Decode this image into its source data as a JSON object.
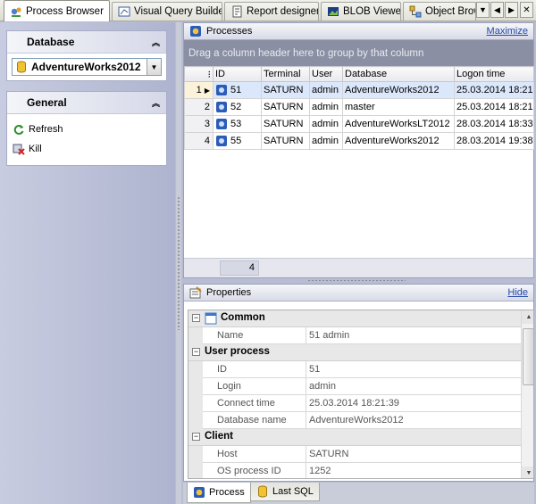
{
  "tabs": [
    {
      "label": "Process Browser",
      "icon": "process-browser-icon",
      "active": true
    },
    {
      "label": "Visual Query Builder",
      "icon": "query-builder-icon",
      "active": false
    },
    {
      "label": "Report designer",
      "icon": "report-designer-icon",
      "active": false
    },
    {
      "label": "BLOB Viewer",
      "icon": "blob-viewer-icon",
      "active": false
    },
    {
      "label": "Object Brow",
      "icon": "object-browser-icon",
      "active": false
    }
  ],
  "left": {
    "database_title": "Database",
    "database_value": "AdventureWorks2012",
    "general_title": "General",
    "actions": [
      {
        "label": "Refresh",
        "icon": "refresh-icon"
      },
      {
        "label": "Kill",
        "icon": "kill-icon"
      }
    ]
  },
  "processes": {
    "title": "Processes",
    "maximize": "Maximize",
    "group_hint": "Drag a column header here to group by that column",
    "columns": [
      "ID",
      "Terminal",
      "User",
      "Database",
      "Logon time"
    ],
    "rows": [
      {
        "n": "1",
        "id": "51",
        "terminal": "SATURN",
        "user": "admin",
        "database": "AdventureWorks2012",
        "logon": "25.03.2014 18:21"
      },
      {
        "n": "2",
        "id": "52",
        "terminal": "SATURN",
        "user": "admin",
        "database": "master",
        "logon": "25.03.2014 18:21"
      },
      {
        "n": "3",
        "id": "53",
        "terminal": "SATURN",
        "user": "admin",
        "database": "AdventureWorksLT2012",
        "logon": "28.03.2014 18:33"
      },
      {
        "n": "4",
        "id": "55",
        "terminal": "SATURN",
        "user": "admin",
        "database": "AdventureWorks2012",
        "logon": "28.03.2014 19:38"
      }
    ],
    "footer_count": "4"
  },
  "properties": {
    "title": "Properties",
    "hide": "Hide",
    "categories": [
      {
        "name": "Common",
        "rows": [
          {
            "k": "Name",
            "v": "51 admin"
          }
        ]
      },
      {
        "name": "User process",
        "rows": [
          {
            "k": "ID",
            "v": "51"
          },
          {
            "k": "Login",
            "v": "admin"
          },
          {
            "k": "Connect time",
            "v": "25.03.2014 18:21:39"
          },
          {
            "k": "Database name",
            "v": "AdventureWorks2012"
          }
        ]
      },
      {
        "name": "Client",
        "rows": [
          {
            "k": "Host",
            "v": "SATURN"
          },
          {
            "k": "OS process ID",
            "v": "1252"
          }
        ]
      }
    ],
    "bottom_tabs": [
      {
        "label": "Process",
        "active": true
      },
      {
        "label": "Last SQL",
        "active": false
      }
    ]
  },
  "colors": {
    "accent": "#2448a8",
    "selection": "#dbe8fb",
    "group_area": "#8b8fa3"
  }
}
